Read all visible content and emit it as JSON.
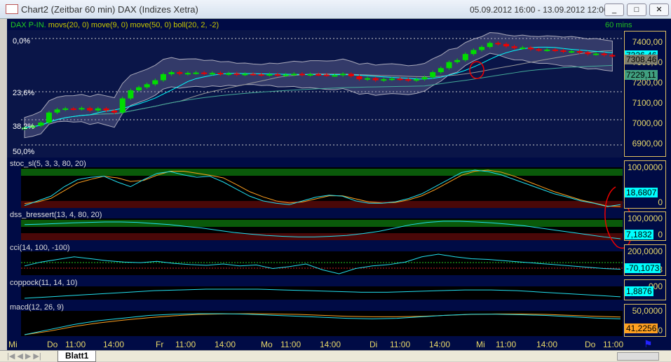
{
  "window": {
    "title": "Chart2 (Zeitbar 60 min)  DAX (Indizes Xetra)",
    "range": "05.09.2012 16:00 - 13.09.2012 12:00",
    "min": "_",
    "max": "□",
    "close": "✕"
  },
  "main": {
    "title": "DAX P-IN.",
    "studies": "movs(20, 0) move(9, 0) move(50, 0) boll(20, 2, -2)",
    "interval": "60 mins",
    "fib": [
      "0,0%",
      "23,6%",
      "38,2%",
      "50,0%"
    ],
    "axis": [
      "7400,00",
      "7300,00",
      "7200,00",
      "7100,00",
      "7000,00",
      "6900,00"
    ],
    "tags": [
      {
        "v": "7326,46",
        "c": "#00ffff"
      },
      {
        "v": "7308,46",
        "c": "#808070"
      },
      {
        "v": "7229,11",
        "c": "#40a080"
      }
    ],
    "closes": [
      6965,
      6975,
      6990,
      7040,
      7055,
      7060,
      7058,
      7062,
      7050,
      7060,
      7050,
      7040,
      7110,
      7150,
      7165,
      7180,
      7200,
      7230,
      7240,
      7232,
      7236,
      7238,
      7232,
      7236,
      7230,
      7234,
      7228,
      7232,
      7230,
      7226,
      7230,
      7225,
      7228,
      7232,
      7226,
      7230,
      7228,
      7225,
      7225,
      7232,
      7220,
      7205,
      7210,
      7200,
      7205,
      7208,
      7205,
      7200,
      7205,
      7215,
      7240,
      7260,
      7290,
      7300,
      7330,
      7350,
      7365,
      7385,
      7380,
      7368,
      7360,
      7362,
      7354,
      7350,
      7352,
      7348,
      7342,
      7344,
      7338,
      7330,
      7332,
      7325,
      7320
    ]
  },
  "panels": [
    {
      "name": "stoc_sl(5, 3, 3, 80, 20)",
      "axis": [
        "100,0000",
        "0"
      ],
      "tag": "18,6807",
      "tagc": "#00ffff",
      "a": [
        20,
        30,
        40,
        60,
        75,
        80,
        82,
        70,
        60,
        75,
        88,
        92,
        85,
        80,
        82,
        70,
        55,
        40,
        30,
        25,
        22,
        30,
        38,
        42,
        40,
        30,
        25,
        25,
        28,
        35,
        45,
        60,
        75,
        90,
        95,
        92,
        85,
        75,
        65,
        55,
        45,
        38,
        30,
        25,
        18,
        22
      ],
      "b": [
        25,
        28,
        35,
        50,
        65,
        72,
        78,
        75,
        68,
        70,
        80,
        88,
        88,
        84,
        80,
        75,
        62,
        48,
        38,
        30,
        26,
        28,
        34,
        40,
        40,
        34,
        28,
        26,
        27,
        32,
        40,
        52,
        66,
        80,
        88,
        90,
        86,
        78,
        68,
        58,
        48,
        40,
        32,
        26,
        20,
        19
      ]
    },
    {
      "name": "dss_bressert(13, 4, 80, 20)",
      "axis": [
        "100,0000",
        "0"
      ],
      "tag": "7,1832",
      "tagc": "#00ffff",
      "a": [
        70,
        72,
        75,
        78,
        80,
        82,
        82,
        80,
        75,
        70,
        62,
        55,
        45,
        35,
        28,
        22,
        18,
        15,
        15,
        18,
        22,
        30,
        40,
        55,
        70,
        80,
        85,
        85,
        82,
        78,
        72,
        65,
        55,
        45,
        35,
        25,
        15,
        7
      ]
    },
    {
      "name": "cci(14, 100, -100)",
      "axis": [
        "200,0000",
        "-70,1073"
      ],
      "tag": "-70,1073",
      "tagc": "#00ffff",
      "a": [
        -20,
        40,
        80,
        120,
        90,
        60,
        40,
        30,
        50,
        20,
        0,
        -10,
        10,
        -20,
        -5,
        -60,
        -30,
        10,
        -80,
        -140,
        -60,
        -20,
        0,
        40,
        120,
        160,
        120,
        90,
        80,
        60,
        40,
        20,
        0,
        -20,
        -40,
        -60,
        -70
      ]
    },
    {
      "name": "coppock(11, 14, 10)",
      "axis": [
        "000"
      ],
      "tag": "1,8876",
      "tagc": "#00ffff",
      "a": [
        0,
        2,
        4,
        6,
        8,
        10,
        11,
        12,
        12,
        12,
        11,
        10,
        9,
        8,
        8,
        9,
        10,
        11,
        11,
        10,
        8,
        6,
        4,
        2
      ]
    },
    {
      "name": "macd(12, 26, 9)",
      "axis": [
        "50,0000",
        "0"
      ],
      "tag": "41,2256",
      "tagc": "#ffa020",
      "a": [
        -20,
        0,
        20,
        35,
        45,
        55,
        60,
        62,
        62,
        60,
        56,
        52,
        48,
        44,
        42,
        44,
        50,
        56,
        60,
        60,
        58,
        55,
        50,
        45,
        42
      ],
      "b": [
        -30,
        -15,
        5,
        20,
        32,
        42,
        50,
        56,
        58,
        59,
        58,
        56,
        52,
        48,
        46,
        46,
        48,
        52,
        56,
        58,
        58,
        56,
        52,
        48,
        45
      ]
    }
  ],
  "time_axis": [
    "Mi",
    "Do",
    "11:00",
    "14:00",
    "Fr",
    "11:00",
    "14:00",
    "Mo",
    "11:00",
    "14:00",
    "Di",
    "11:00",
    "14:00",
    "Mi",
    "11:00",
    "14:00",
    "Do",
    "11:00"
  ],
  "sheet": {
    "tab": "Blatt1"
  }
}
